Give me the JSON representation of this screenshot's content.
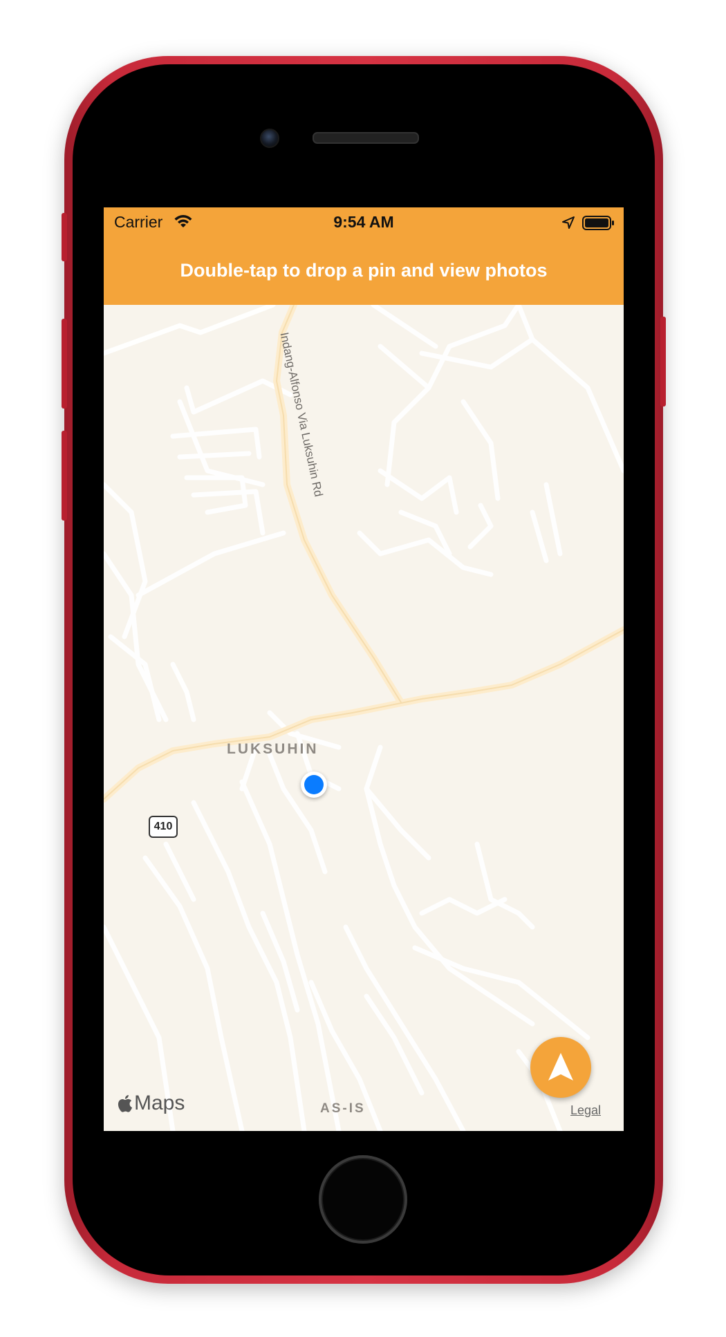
{
  "status_bar": {
    "carrier": "Carrier",
    "time": "9:54 AM",
    "wifi_icon": "wifi-icon",
    "location_icon": "location-arrow-icon",
    "battery_icon": "battery-full-icon"
  },
  "nav": {
    "title": "Double-tap to drop a pin and view photos",
    "background_color": "#f4a43a"
  },
  "map": {
    "place_label": "LUKSUHIN",
    "place_label_bottom": "AS-IS",
    "road_label": "Indang-Alfonso Via Luksuhin Rd",
    "route_shield": "410",
    "maps_brand": "Maps",
    "legal_link": "Legal",
    "user_location_color": "#0a7cff"
  },
  "locate_button": {
    "icon": "navigation-arrow-icon",
    "color": "#f4a43a"
  }
}
